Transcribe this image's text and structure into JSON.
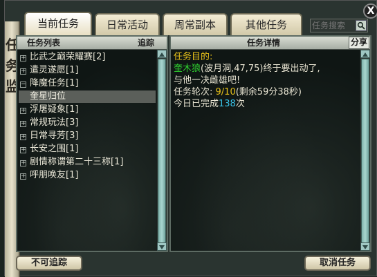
{
  "window": {
    "left_deco_glyphs": [
      "任",
      "务",
      "监"
    ],
    "close_label": "X"
  },
  "tabs": [
    {
      "label": "当前任务",
      "active": true
    },
    {
      "label": "日常活动",
      "active": false
    },
    {
      "label": "周常副本",
      "active": false
    },
    {
      "label": "其他任务",
      "active": false
    }
  ],
  "search": {
    "placeholder": "任务搜索"
  },
  "task_list": {
    "header_title": "任务列表",
    "header_track": "追踪",
    "items": [
      {
        "label": "比武之巅荣耀赛[2]",
        "type": "group"
      },
      {
        "label": "遣灵遂愿[1]",
        "type": "group"
      },
      {
        "label": "降魔任务[1]",
        "type": "group"
      },
      {
        "label": "奎星归位",
        "type": "sub",
        "selected": true
      },
      {
        "label": "浮屠疑象[1]",
        "type": "group"
      },
      {
        "label": "常规玩法[3]",
        "type": "group"
      },
      {
        "label": "日常寻芳[3]",
        "type": "group"
      },
      {
        "label": "长安之围[1]",
        "type": "group"
      },
      {
        "label": "剧情称谓第二十三称[1]",
        "type": "group"
      },
      {
        "label": "呼朋唤友[1]",
        "type": "group"
      }
    ]
  },
  "task_detail": {
    "header_title": "任务详情",
    "share_label": "分享",
    "goal_label": "任务目的:",
    "npc_name": "奎木狼",
    "location": "(波月洞,47,75)终于要出动了,",
    "line2": "与他一决雌雄吧!",
    "round_label": "任务轮次:",
    "round_value": "9/10",
    "round_remaining": "(剩余59分38秒)",
    "today_prefix": "今日已完成",
    "today_count": "138",
    "today_suffix": "次"
  },
  "footer": {
    "untrack_label": "不可追踪",
    "cancel_label": "取消任务"
  },
  "colors": {
    "goal": "#e8c21a",
    "npc": "#2fd12f",
    "round_value": "#e8c21a",
    "count": "#39c3e8"
  }
}
